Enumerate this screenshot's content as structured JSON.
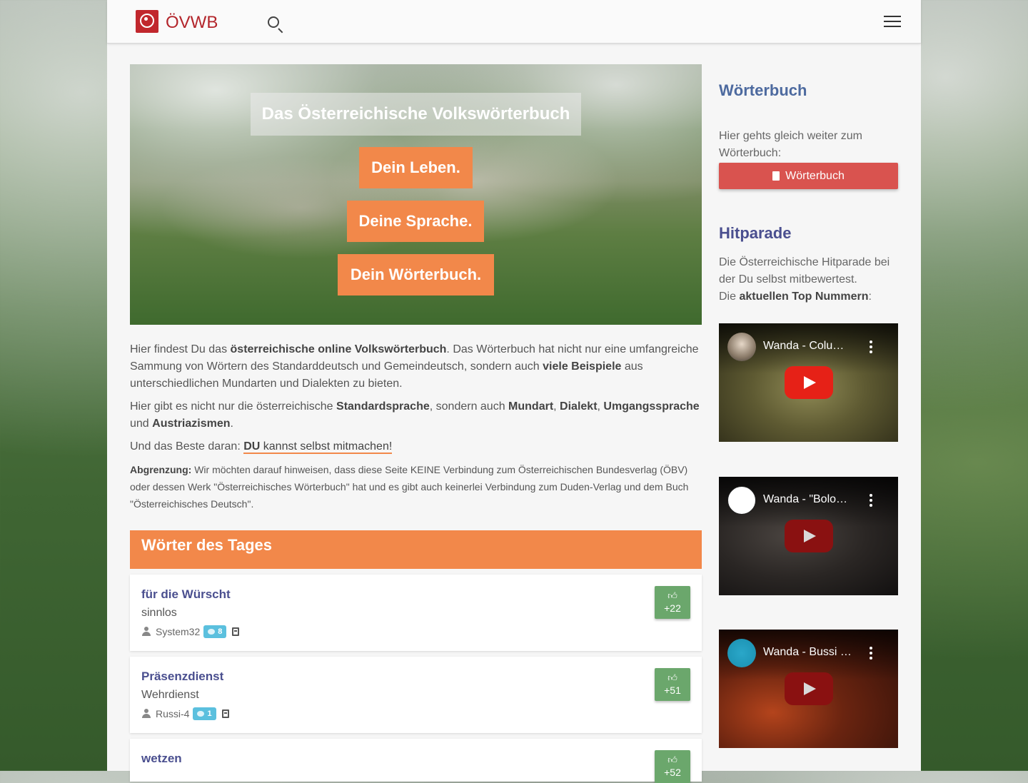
{
  "brand": {
    "name": "ÖVWB"
  },
  "hero": {
    "title": "Das Österreichische Volkswörterbuch",
    "buttons": [
      "Dein Leben.",
      "Deine Sprache.",
      "Dein Wörterbuch."
    ]
  },
  "intro": {
    "p1_a": "Hier findest Du das ",
    "p1_b": "österreichische online Volkswörterbuch",
    "p1_c": ". Das Wörterbuch hat nicht nur eine umfangreiche Sammung von Wörtern des Standarddeutsch und Gemeindeutsch, sondern auch ",
    "p1_d": "viele Beispiele",
    "p1_e": " aus unterschiedlichen Mundarten und Dialekten zu bieten.",
    "p2_a": "Hier gibt es nicht nur die österreichische ",
    "p2_b": "Standardsprache",
    "p2_c": ", sondern auch ",
    "p2_d": "Mundart",
    "p2_e": ", ",
    "p2_f": "Dialekt",
    "p2_g": ", ",
    "p2_h": "Umgangssprache",
    "p2_i": " und ",
    "p2_j": "Austriazismen",
    "p2_k": ".",
    "p3_a": "Und das Beste daran: ",
    "p3_b": "DU",
    "p3_c": " kannst selbst mitmachen!",
    "p4_a": "Abgrenzung:",
    "p4_b": " Wir möchten darauf hinweisen, dass diese Seite KEINE Verbindung zum Österreichischen Bundesverlag (ÖBV) oder dessen Werk \"Österreichisches Wörterbuch\" hat und es gibt auch keinerlei Verbindung zum Duden-Verlag und dem Buch \"Österreichisches Deutsch\"."
  },
  "words_of_day": {
    "heading": "Wörter des Tages",
    "items": [
      {
        "word": "für die Würscht",
        "meaning": "sinnlos",
        "user": "System32",
        "comments": "8",
        "votes": "+22"
      },
      {
        "word": "Präsenzdienst",
        "meaning": "Wehrdienst",
        "user": "Russi-4",
        "comments": "1",
        "votes": "+51"
      },
      {
        "word": "wetzen",
        "meaning": "",
        "user": "",
        "comments": "",
        "votes": "+52"
      }
    ]
  },
  "sidebar": {
    "dict_heading": "Wörterbuch",
    "dict_text": "Hier gehts gleich weiter zum Wörterbuch:",
    "dict_button": "Wörterbuch",
    "hit_heading": "Hitparade",
    "hit_text_1": "Die Österreichische Hitparade bei der Du selbst mitbewertest.",
    "hit_text_2a": "Die ",
    "hit_text_2b": "aktuellen Top Nummern",
    "hit_text_2c": ":",
    "videos": [
      {
        "title": "Wanda - Colu…"
      },
      {
        "title": "Wanda - \"Bolo…"
      },
      {
        "title": "Wanda - Bussi …"
      }
    ]
  },
  "colors": {
    "accent_orange": "#f2884a",
    "brand_red": "#c1272d",
    "vote_green": "#6ba76c",
    "heading_blue": "#4d6a9f",
    "button_red": "#d9534f"
  },
  "icons": [
    "logo-icon",
    "search-icon",
    "menu-icon",
    "user-icon",
    "comment-icon",
    "book-icon",
    "thumbs-up-icon",
    "play-icon",
    "more-options-icon"
  ]
}
